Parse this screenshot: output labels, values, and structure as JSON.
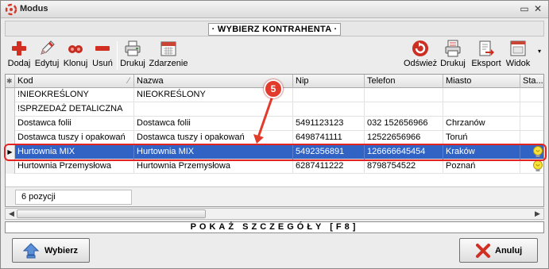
{
  "window": {
    "title": "Modus"
  },
  "header": {
    "title": "· WYBIERZ KONTRAHENTA ·"
  },
  "toolbar": {
    "left": [
      {
        "label": "Dodaj",
        "icon": "plus-icon"
      },
      {
        "label": "Edytuj",
        "icon": "pencil-icon"
      },
      {
        "label": "Klonuj",
        "icon": "clone-icon"
      },
      {
        "label": "Usuń",
        "icon": "minus-icon"
      },
      {
        "label": "Drukuj",
        "icon": "printer-icon"
      },
      {
        "label": "Zdarzenie",
        "icon": "calendar-icon"
      }
    ],
    "right": [
      {
        "label": "Odśwież",
        "icon": "refresh-icon"
      },
      {
        "label": "Drukuj",
        "icon": "print-list-icon"
      },
      {
        "label": "Eksport",
        "icon": "export-icon"
      },
      {
        "label": "Widok",
        "icon": "window-view-icon"
      }
    ]
  },
  "grid": {
    "columns": [
      "Kod",
      "Nazwa",
      "Nip",
      "Telefon",
      "Miasto",
      "Sta..."
    ],
    "rows": [
      {
        "kod": "!NIEOKREŚLONY",
        "nazwa": "NIEOKREŚLONY",
        "nip": "",
        "telefon": "",
        "miasto": "",
        "status": ""
      },
      {
        "kod": "!SPRZEDAŻ DETALICZNA",
        "nazwa": "",
        "nip": "",
        "telefon": "",
        "miasto": "",
        "status": ""
      },
      {
        "kod": "Dostawca folii",
        "nazwa": "Dostawca folii",
        "nip": "5491123123",
        "telefon": "032 152656966",
        "miasto": "Chrzanów",
        "status": ""
      },
      {
        "kod": "Dostawca tuszy i opakowań",
        "nazwa": "Dostawca tuszy i opakowań",
        "nip": "6498741111",
        "telefon": "12522656966",
        "miasto": "Toruń",
        "status": ""
      },
      {
        "kod": "Hurtownia MIX",
        "nazwa": "Hurtownia MIX",
        "nip": "5492356891",
        "telefon": "126666645454",
        "miasto": "Kraków",
        "status": "lightbulb"
      },
      {
        "kod": "Hurtownia Przemysłowa",
        "nazwa": "Hurtownia Przemysłowa",
        "nip": "6287411222",
        "telefon": "8798754522",
        "miasto": "Poznań",
        "status": "lightbulb"
      }
    ],
    "selected_row": "Hurtownia MIX",
    "count_text": "6 pozycji"
  },
  "details": {
    "label": "POKAŻ SZCZEGÓŁY [F8]"
  },
  "buttons": {
    "select": "Wybierz",
    "cancel": "Anuluj"
  },
  "annotation": {
    "step": "5"
  },
  "colors": {
    "selection": "#3163c5",
    "callout": "#e23a2b",
    "highlight_border": "#e52222"
  }
}
